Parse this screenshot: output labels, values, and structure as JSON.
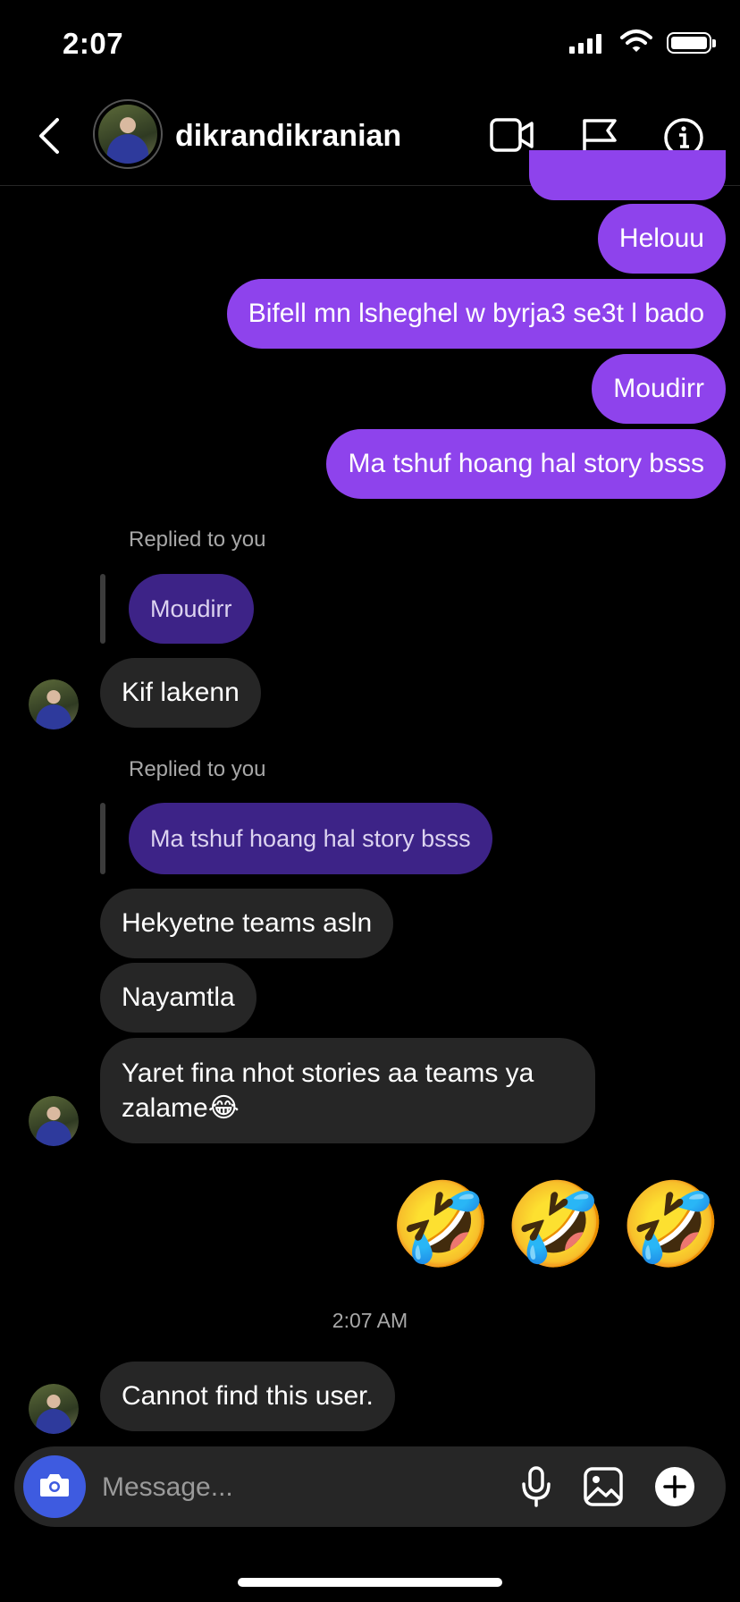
{
  "status_bar": {
    "time": "2:07"
  },
  "header": {
    "username": "dikrandikranian"
  },
  "messages": {
    "sent": [
      "Helouu",
      "Bifell mn lsheghel w byrja3 se3t l bado",
      "Moudirr",
      "Ma tshuf hoang hal story bsss"
    ],
    "reply_label_1": "Replied to you",
    "reply_quote_1": "Moudirr",
    "received_1": "Kif lakenn",
    "reply_label_2": "Replied to you",
    "reply_quote_2": "Ma tshuf hoang hal story bsss",
    "received_2": "Hekyetne teams asln",
    "received_3": "Nayamtla",
    "received_4_line1": "Yaret fina nhot stories aa teams ya",
    "received_4_line2": "zalame😂",
    "sent_emoji": "🤣🤣🤣",
    "timestamp": "2:07 AM",
    "received_5": "Cannot find this user."
  },
  "composer": {
    "placeholder": "Message..."
  },
  "colors": {
    "sent_bubble": "#8e43ec",
    "received_bubble": "#262626",
    "reply_quote": "#3d2387",
    "camera_button": "#3e5be0"
  },
  "icons": [
    "back-chevron-icon",
    "video-call-icon",
    "flag-icon",
    "info-icon",
    "camera-icon",
    "microphone-icon",
    "gallery-icon",
    "plus-icon"
  ]
}
